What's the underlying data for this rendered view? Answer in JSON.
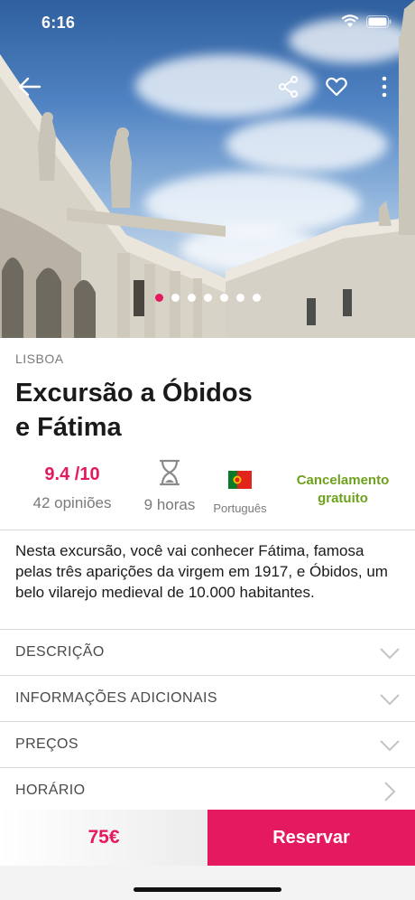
{
  "status_bar": {
    "time": "6:16"
  },
  "hero": {
    "icons": {
      "back": "arrow-left-icon",
      "share": "share-icon",
      "favorite": "heart-icon",
      "more": "more-vertical-icon"
    },
    "carousel": {
      "total": 7,
      "active": 0
    }
  },
  "tour": {
    "city": "LISBOA",
    "title_line1": "Excursão a Óbidos",
    "title_line2": "e Fátima",
    "rating_value": "9.4 /10",
    "rating_count": "42 opiniões",
    "duration": "9 horas",
    "language": "Português",
    "cancel_line1": "Cancelamento",
    "cancel_line2": "gratuito",
    "description": "Nesta excursão, você vai conhecer Fátima, famosa pelas três aparições da virgem em 1917, e Óbidos, um belo vilarejo medieval de 10.000 habitantes."
  },
  "sections": [
    {
      "label": "DESCRIÇÃO",
      "icon": "chevron-down-icon"
    },
    {
      "label": "INFORMAÇÕES ADICIONAIS",
      "icon": "chevron-down-icon"
    },
    {
      "label": "PREÇOS",
      "icon": "chevron-down-icon"
    },
    {
      "label": "HORÁRIO",
      "icon": "chevron-right-icon"
    }
  ],
  "booking": {
    "price": "75€",
    "reserve_label": "Reservar"
  },
  "colors": {
    "accent": "#e5195f",
    "green": "#6ea21d",
    "muted": "#7a7a7a"
  }
}
